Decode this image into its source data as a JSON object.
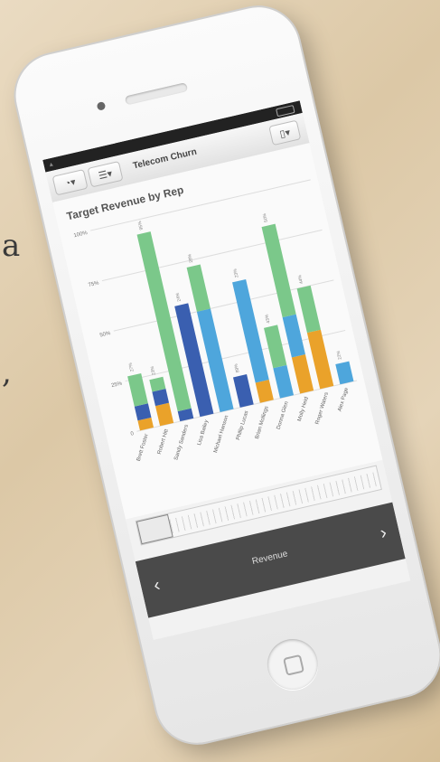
{
  "background": {
    "left_text_1": "a",
    "left_text_2": ","
  },
  "app": {
    "title": "Telecom Churn",
    "toolbar_icons": [
      "gauge-icon",
      "list-icon",
      "device-icon"
    ]
  },
  "bottom_nav": {
    "label": "Revenue",
    "prev": "‹",
    "next": "›"
  },
  "colors": {
    "green": "#7bc88a",
    "lightblue": "#4ea6dc",
    "darkblue": "#3a5fb0",
    "orange": "#eaa22a",
    "grid": "#dddddd"
  },
  "chart_data": {
    "type": "bar",
    "title": "Target Revenue by Rep",
    "ylim": [
      0,
      100
    ],
    "yticks": [
      "100%",
      "75%",
      "50%",
      "25%",
      "0"
    ],
    "categories": [
      "Brett Foster",
      "Robert Hitt",
      "Sandy Sanders",
      "Lisa Bailey",
      "Michael Hanson",
      "Phillip Lucas",
      "Brian Mollings",
      "Donna Glen",
      "Molly Heid",
      "Roger Waters",
      "Alex Page"
    ],
    "bar_labels": [
      "27%",
      "23%",
      "95%",
      "24%",
      "28%",
      "89%",
      "23%",
      "43%",
      "50%",
      "44%",
      "22%"
    ],
    "series": [
      {
        "color": "orange",
        "values": [
          5,
          10,
          0,
          0,
          0,
          0,
          10,
          0,
          18,
          28,
          0
        ]
      },
      {
        "color": "darkblue",
        "values": [
          7,
          7,
          5,
          55,
          0,
          15,
          0,
          0,
          0,
          0,
          0
        ]
      },
      {
        "color": "lightblue",
        "values": [
          0,
          0,
          0,
          0,
          50,
          0,
          50,
          15,
          20,
          0,
          10
        ]
      },
      {
        "color": "green",
        "values": [
          15,
          6,
          88,
          0,
          22,
          0,
          0,
          20,
          45,
          22,
          0
        ]
      }
    ]
  }
}
